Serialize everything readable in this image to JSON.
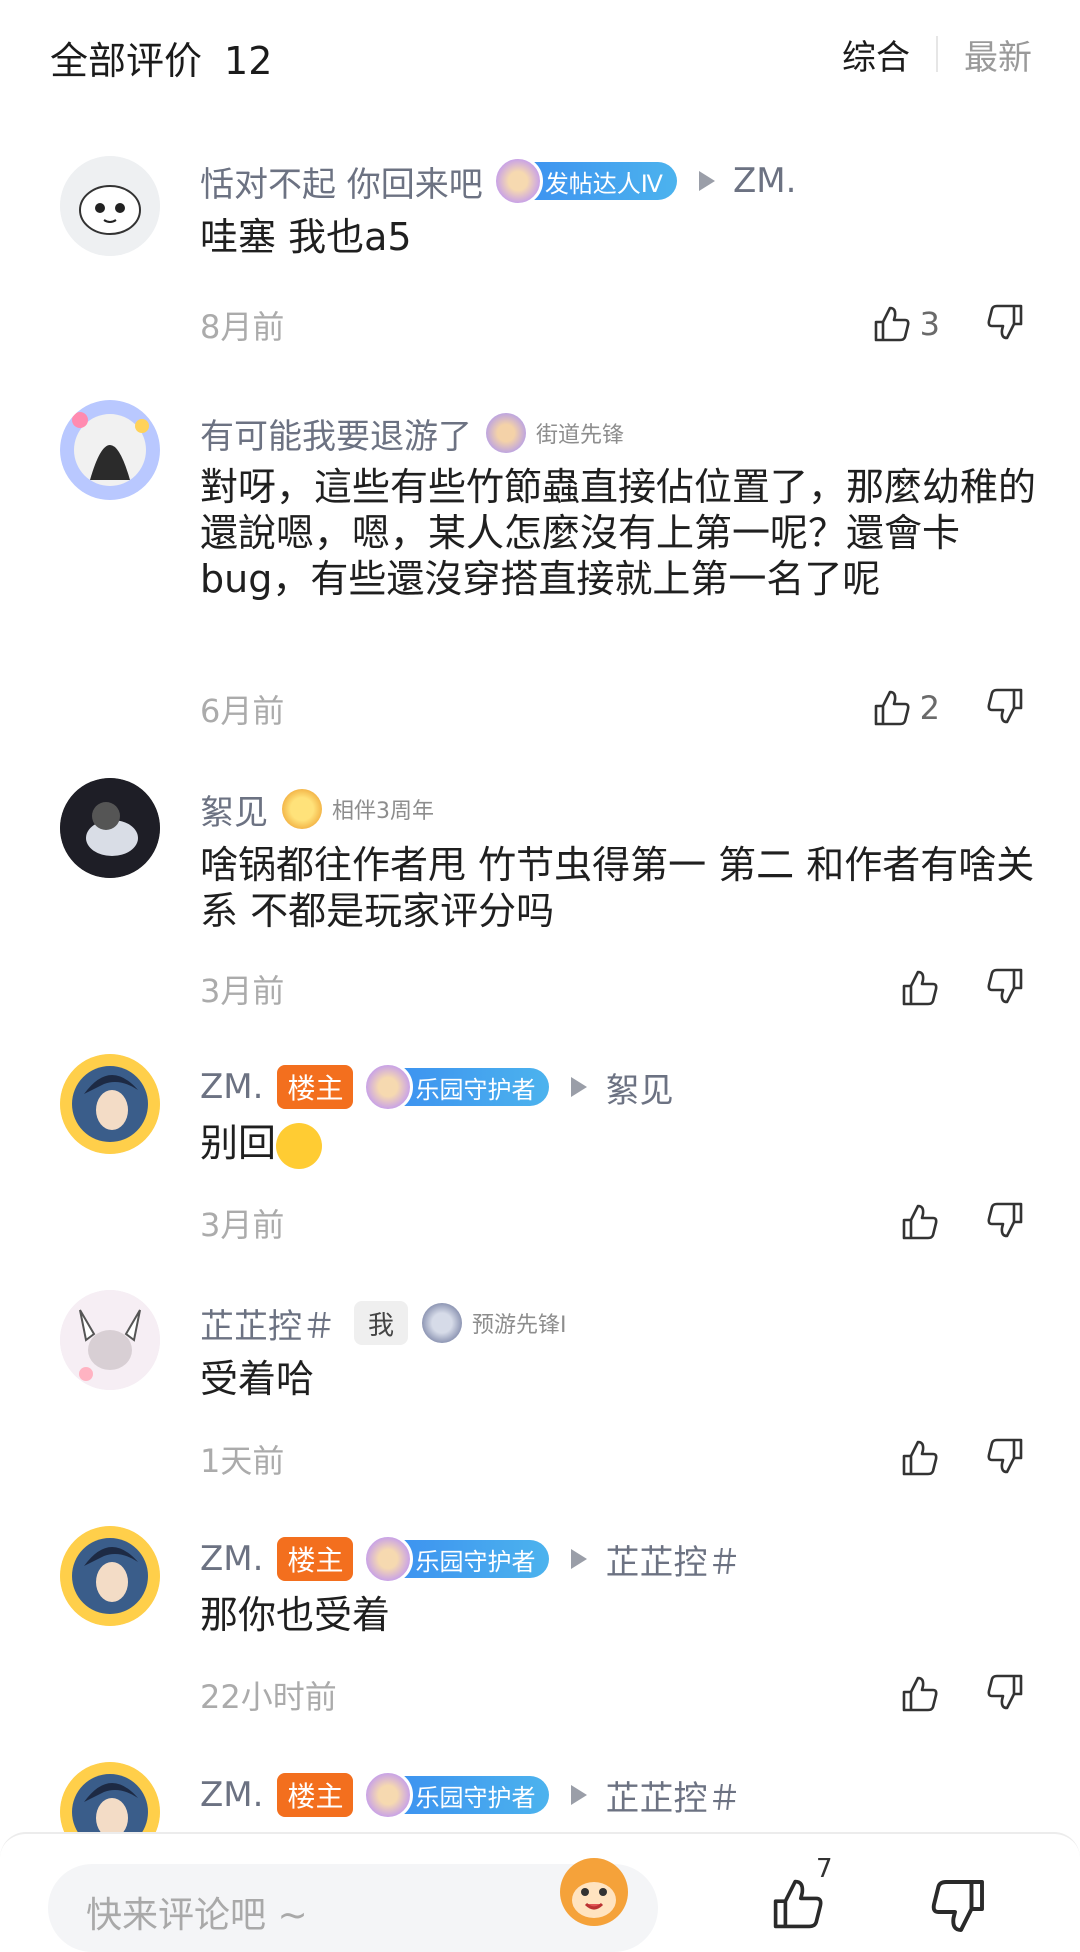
{
  "header": {
    "title": "全部评价",
    "count": "12",
    "sort_tabs": [
      "综合",
      "最新"
    ]
  },
  "comments": [
    {
      "name": "恬对不起 你回来吧",
      "badge": "发帖达人Ⅳ",
      "reply_to": "ZM.",
      "body": "哇塞 我也a5",
      "time": "8月前",
      "likes": "3"
    },
    {
      "name": "有可能我要退游了",
      "badge": "街道先锋",
      "body": "對呀，這些有些竹節蟲直接佔位置了，那麼幼稚的還說嗯，嗯，某人怎麼沒有上第一呢？還會卡bug，有些還沒穿搭直接就上第一名了呢",
      "time": "6月前",
      "likes": "2"
    },
    {
      "name": "絮见",
      "badge": "相伴3周年",
      "body": "啥锅都往作者甩 竹节虫得第一 第二 和作者有啥关系 不都是玩家评分吗",
      "time": "3月前"
    },
    {
      "name": "ZM.",
      "owner_tag": "楼主",
      "badge": "乐园守护者",
      "reply_to": "絮见",
      "body": "别回",
      "time": "3月前"
    },
    {
      "name": "芷芷控＃",
      "self_tag": "我",
      "badge": "预游先锋Ⅰ",
      "body": "受着哈",
      "time": "1天前"
    },
    {
      "name": "ZM.",
      "owner_tag": "楼主",
      "badge": "乐园守护者",
      "reply_to": "芷芷控＃",
      "body": "那你也受着",
      "time": "22小时前"
    },
    {
      "name": "ZM.",
      "owner_tag": "楼主",
      "badge": "乐园守护者",
      "reply_to": "芷芷控＃"
    }
  ],
  "bottom_bar": {
    "placeholder": "快来评论吧 ~",
    "like_count": "7"
  },
  "icons": {
    "like": "thumbs-up-icon",
    "dislike": "thumbs-down-icon",
    "reply": "reply-arrow-icon",
    "emoji": "laughing-emoji-icon"
  },
  "colors": {
    "owner_tag": "#f36f1e",
    "badge_blue": "#3a8cf0",
    "name_gray": "#6c7282"
  }
}
